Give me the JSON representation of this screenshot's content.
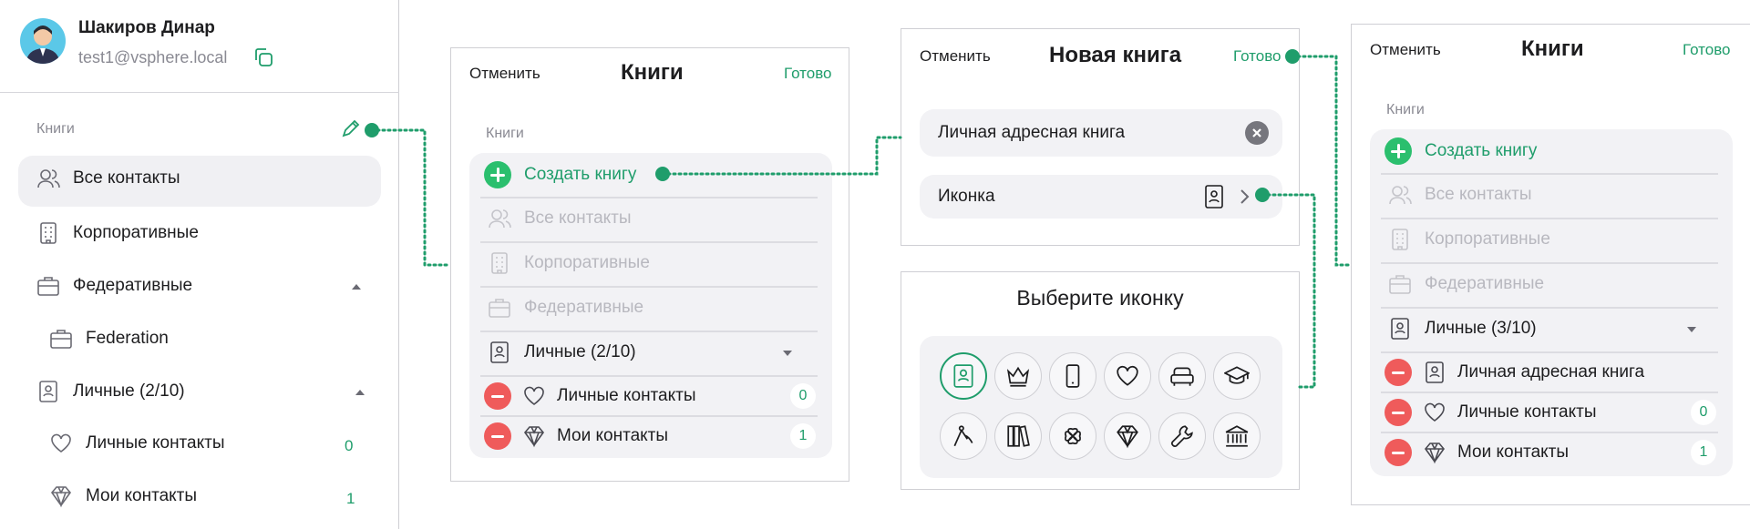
{
  "colors": {
    "accent": "#1f9d6b",
    "danger": "#ef5b5b",
    "add": "#2bbf6e",
    "card": "#f2f2f5",
    "disabled": "#b8b8bf"
  },
  "sidebar": {
    "user_name": "Шакиров Динар",
    "user_email": "test1@vsphere.local",
    "section_title": "Книги",
    "items": [
      {
        "label": "Все контакты",
        "icon": "users-icon"
      },
      {
        "label": "Корпоративные",
        "icon": "building-icon"
      },
      {
        "label": "Федеративные",
        "icon": "briefcase-icon"
      },
      {
        "label": "Federation",
        "icon": "briefcase-icon"
      },
      {
        "label": "Личные (2/10)",
        "icon": "contact-book-icon"
      },
      {
        "label": "Личные контакты",
        "icon": "heart-icon",
        "count": "0"
      },
      {
        "label": "Мои контакты",
        "icon": "diamond-icon",
        "count": "1"
      }
    ]
  },
  "books_edit": {
    "cancel": "Отменить",
    "title": "Книги",
    "done": "Готово",
    "section_title": "Книги",
    "create": "Создать книгу",
    "items": [
      {
        "label": "Все контакты"
      },
      {
        "label": "Корпоративные"
      },
      {
        "label": "Федеративные"
      },
      {
        "label": "Личные (2/10)"
      },
      {
        "label": "Личные контакты",
        "count": "0"
      },
      {
        "label": "Мои контакты",
        "count": "1"
      }
    ]
  },
  "new_book": {
    "cancel": "Отменить",
    "title": "Новая книга",
    "done": "Готово",
    "name_value": "Личная адресная книга",
    "icon_label": "Иконка"
  },
  "icon_picker": {
    "title": "Выберите иконку",
    "icons": [
      "contact-book-icon",
      "crown-icon",
      "phone-icon",
      "heart-icon",
      "sofa-icon",
      "graduation-cap-icon",
      "compass-icon",
      "books-icon",
      "clover-icon",
      "diamond-icon",
      "wrench-icon",
      "bank-icon"
    ]
  },
  "books_result": {
    "cancel": "Отменить",
    "title": "Книги",
    "done": "Готово",
    "section_title": "Книги",
    "create": "Создать книгу",
    "items": [
      {
        "label": "Все контакты"
      },
      {
        "label": "Корпоративные"
      },
      {
        "label": "Федеративные"
      },
      {
        "label": "Личные (3/10)"
      },
      {
        "label": "Личная адресная книга"
      },
      {
        "label": "Личные контакты",
        "count": "0"
      },
      {
        "label": "Мои контакты",
        "count": "1"
      }
    ]
  }
}
